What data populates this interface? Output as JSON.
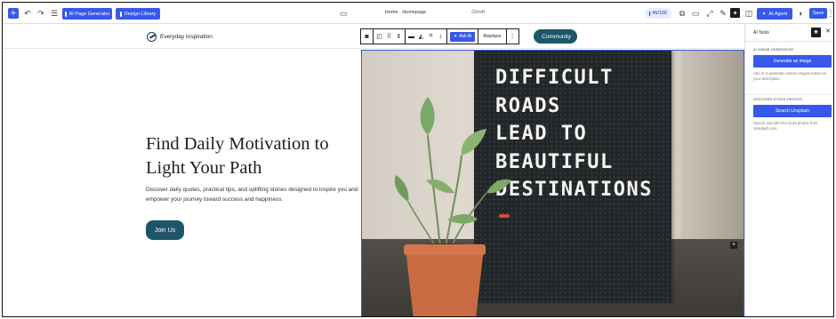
{
  "toolbar": {
    "ai_page_generator": "AI Page Generator",
    "design_library": "Design Library",
    "document_title": "Home · Homepage",
    "command_shortcut": "Ctrl+K",
    "score": "45/100",
    "ai_agent": "AI Agent",
    "save": "Save"
  },
  "site_header": {
    "logo_text": "Everyday Inspiration",
    "nav_button_partial": "Community"
  },
  "block_toolbar": {
    "ask_ai": "Ask AI",
    "replace": "Replace"
  },
  "hero": {
    "title": "Find Daily Motivation to Light Your Path",
    "description": "Discover daily quotes, practical tips, and uplifting stories designed to inspire you and empower your journey toward success and happiness.",
    "cta": "Join Us",
    "board_lines": [
      "DIFFICULT",
      "ROADS",
      "LEAD TO",
      "BEAUTIFUL",
      "DESTINATIONS"
    ]
  },
  "ai_panel": {
    "title": "AI Tools",
    "generator_label": "AI IMAGE GENERATOR",
    "generate_button": "Generate an image",
    "generator_help": "Use AI to generate custom images based on your description.",
    "stock_label": "DISCOVER STOCK PHOTOS",
    "stock_button": "Search Unsplash",
    "stock_help": "Search and add free stock photos from Unsplash.com"
  },
  "colors": {
    "accent": "#3858e9",
    "brand_teal": "#1e5568",
    "board": "#232628"
  },
  "icons": [
    "plus-icon",
    "undo-icon",
    "redo-icon",
    "document-overview-icon",
    "command-icon",
    "view-icon",
    "desktop-icon",
    "external-link-icon",
    "pin-icon",
    "sparkle-icon",
    "sidebar-icon",
    "contrast-icon",
    "more-icon",
    "star-icon",
    "close-icon"
  ]
}
